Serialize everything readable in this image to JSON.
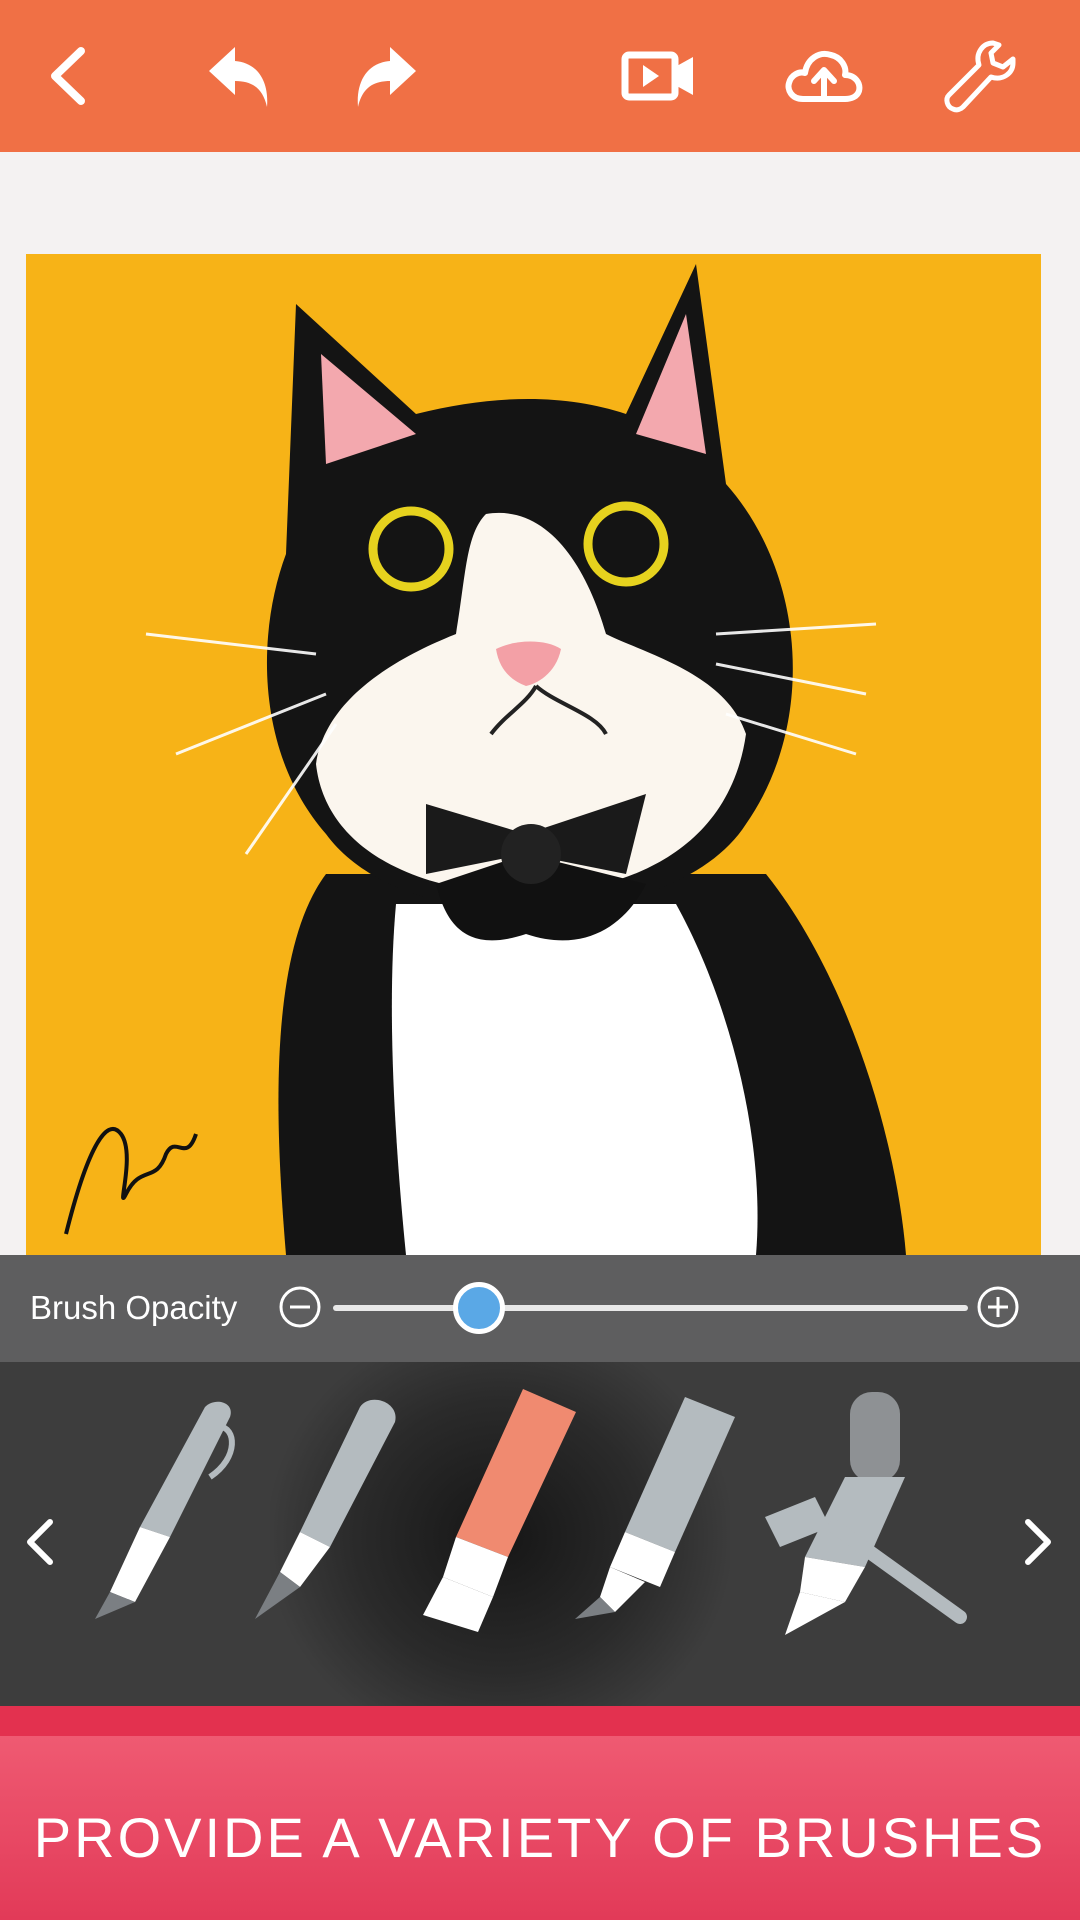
{
  "toolbar": {
    "icons": [
      "back-icon",
      "undo-icon",
      "redo-icon",
      "video-record-icon",
      "cloud-upload-icon",
      "wrench-settings-icon"
    ],
    "color": "#f07045"
  },
  "opacity": {
    "label": "Brush Opacity",
    "value_fraction": 0.23,
    "knob_color": "#5aa8e6"
  },
  "brushes": {
    "items": [
      "pen",
      "pencil",
      "marker",
      "highlighter",
      "airbrush"
    ],
    "selected": "marker",
    "selected_color": "#f08a70",
    "default_color": "#b4bbbf"
  },
  "banner": {
    "text": "PROVIDE A VARIETY OF BRUSHES"
  },
  "artwork": {
    "background": "#f7b317",
    "subject": "tuxedo cat with bow tie"
  }
}
